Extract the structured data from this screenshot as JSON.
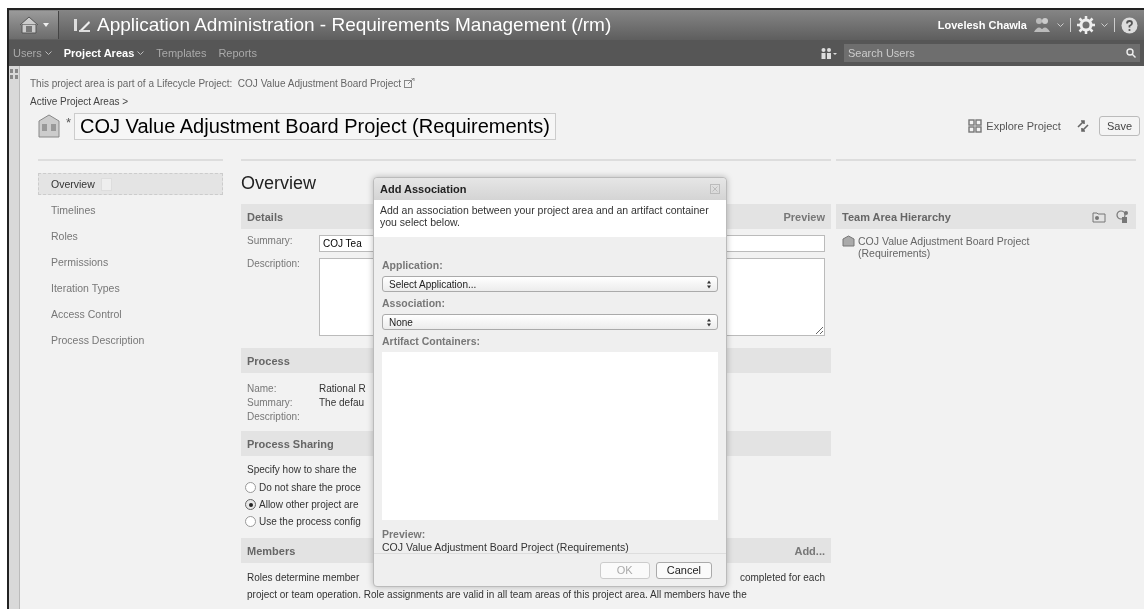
{
  "app_bar": {
    "title": "Application Administration - Requirements Management (/rm)",
    "user": "Lovelesh Chawla"
  },
  "nav": [
    {
      "label": "Users",
      "selected": false,
      "dropdown": true
    },
    {
      "label": "Project Areas",
      "selected": true,
      "dropdown": true
    },
    {
      "label": "Templates",
      "selected": false,
      "dropdown": false
    },
    {
      "label": "Reports",
      "selected": false,
      "dropdown": false
    }
  ],
  "user_search": {
    "placeholder": "Search Users"
  },
  "lifecycle_notice": "This project area is part of a Lifecycle Project:  COJ Value Adjustment Board Project",
  "breadcrumb": "Active Project Areas >",
  "project_name": {
    "value": "COJ Value Adjustment Board Project (Requirements)",
    "required_mark": "*"
  },
  "actions": {
    "explore": "Explore Project",
    "save": "Save"
  },
  "sidebar": {
    "items": [
      {
        "label": "Overview",
        "selected": true
      },
      {
        "label": "Timelines",
        "selected": false
      },
      {
        "label": "Roles",
        "selected": false
      },
      {
        "label": "Permissions",
        "selected": false
      },
      {
        "label": "Iteration Types",
        "selected": false
      },
      {
        "label": "Access Control",
        "selected": false
      },
      {
        "label": "Process Description",
        "selected": false
      }
    ]
  },
  "overview": {
    "heading": "Overview",
    "details": {
      "header": "Details",
      "action": "Preview",
      "summary_label": "Summary:",
      "summary_value": "COJ Tea",
      "description_label": "Description:"
    },
    "process": {
      "header": "Process",
      "rows": [
        {
          "label": "Name:",
          "value": "Rational R"
        },
        {
          "label": "Summary:",
          "value": "The defau"
        },
        {
          "label": "Description:"
        }
      ]
    },
    "process_sharing": {
      "header": "Process Sharing",
      "prompt": "Specify how to share the",
      "options": [
        {
          "label": "Do not share the proce",
          "selected": false
        },
        {
          "label": "Allow other project are",
          "selected": true
        },
        {
          "label": "Use the process config",
          "selected": false
        }
      ]
    },
    "members": {
      "header": "Members",
      "action": "Add...",
      "text_left": "Roles determine member",
      "text_right": "completed for each",
      "text_line_2": "project or team operation. Role assignments are valid in all team areas of this project area. All members have the"
    }
  },
  "team_area_hierarchy": {
    "header": "Team Area Hierarchy",
    "items": [
      {
        "label": "COJ Value Adjustment Board Project (Requirements)"
      }
    ]
  },
  "dialog": {
    "title": "Add Association",
    "intro": "Add an association between your project area and an artifact container you select below.",
    "application_label": "Application:",
    "application_value": "Select Application...",
    "association_label": "Association:",
    "association_value": "None",
    "containers_label": "Artifact Containers:",
    "preview_label": "Preview:",
    "preview_value": "COJ Value Adjustment Board Project (Requirements)",
    "ok": {
      "label": "OK",
      "disabled": true
    },
    "cancel": {
      "label": "Cancel",
      "disabled": false
    }
  }
}
